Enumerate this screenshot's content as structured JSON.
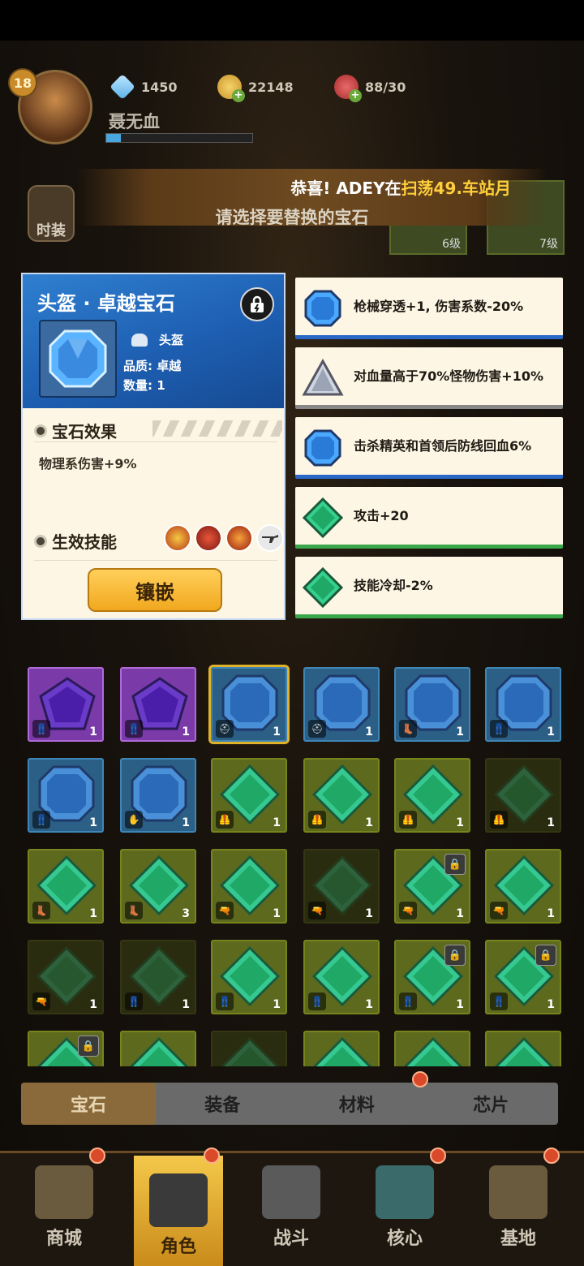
{
  "hud": {
    "level": "18",
    "player_name": "聂无血",
    "xp_fraction": 0.1,
    "diamonds": "1450",
    "coins": "22148",
    "stamina": "88/30"
  },
  "news": {
    "prefix": "恭喜! ADEY在",
    "highlight": "扫荡49.车站月",
    "prompt": "请选择要替换的宝石"
  },
  "side": {
    "costume_label": "时装"
  },
  "behind": {
    "item_level_1": "6级",
    "item_level_2": "7级"
  },
  "detail": {
    "title": "头盔 · 卓越宝石",
    "slot_label": "头盔",
    "quality_line": "品质: 卓越",
    "quantity_line": "数量: 1",
    "effect_title": "宝石效果",
    "effect_text": "物理系伤害+9%",
    "skill_title": "生效技能",
    "skills": [
      "skill-1",
      "skill-2",
      "skill-3",
      "skill-rifle"
    ],
    "inlay_label": "镶嵌"
  },
  "replace_options": [
    {
      "text": "枪械穿透+1, 伤害系数-20%",
      "gem": "blue"
    },
    {
      "text": "对血量高于70%怪物伤害+10%",
      "gem": "grey"
    },
    {
      "text": "击杀精英和首领后防线回血6%",
      "gem": "blue"
    },
    {
      "text": "攻击+20",
      "gem": "green"
    },
    {
      "text": "技能冷却-2%",
      "gem": "green"
    }
  ],
  "inventory": [
    {
      "color": "purple",
      "count": "1",
      "slot": "pants"
    },
    {
      "color": "purple",
      "count": "1",
      "slot": "pants"
    },
    {
      "color": "blue",
      "count": "1",
      "slot": "helmet",
      "selected": true
    },
    {
      "color": "blue",
      "count": "1",
      "slot": "helmet"
    },
    {
      "color": "blue",
      "count": "1",
      "slot": "boots"
    },
    {
      "color": "blue",
      "count": "1",
      "slot": "pants"
    },
    {
      "color": "blue",
      "count": "1",
      "slot": "pants"
    },
    {
      "color": "blue",
      "count": "1",
      "slot": "glove"
    },
    {
      "color": "green",
      "count": "1",
      "slot": "armor"
    },
    {
      "color": "green",
      "count": "1",
      "slot": "armor"
    },
    {
      "color": "green",
      "count": "1",
      "slot": "armor"
    },
    {
      "color": "dark",
      "count": "1",
      "slot": "armor"
    },
    {
      "color": "green",
      "count": "1",
      "slot": "boots"
    },
    {
      "color": "green",
      "count": "3",
      "slot": "boots"
    },
    {
      "color": "green",
      "count": "1",
      "slot": "gun"
    },
    {
      "color": "dark",
      "count": "1",
      "slot": "gun"
    },
    {
      "color": "green",
      "count": "1",
      "slot": "gun",
      "locked": true
    },
    {
      "color": "green",
      "count": "1",
      "slot": "gun"
    },
    {
      "color": "dark",
      "count": "1",
      "slot": "gun"
    },
    {
      "color": "dark",
      "count": "1",
      "slot": "pants"
    },
    {
      "color": "green",
      "count": "1",
      "slot": "pants"
    },
    {
      "color": "green",
      "count": "1",
      "slot": "pants"
    },
    {
      "color": "green",
      "count": "1",
      "slot": "pants",
      "locked": true
    },
    {
      "color": "green",
      "count": "1",
      "slot": "pants",
      "locked": true
    },
    {
      "color": "green",
      "count": "",
      "slot": "",
      "locked": true
    },
    {
      "color": "green",
      "count": "",
      "slot": ""
    },
    {
      "color": "dark",
      "count": "",
      "slot": ""
    },
    {
      "color": "green",
      "count": "",
      "slot": ""
    },
    {
      "color": "green",
      "count": "",
      "slot": ""
    },
    {
      "color": "green",
      "count": "",
      "slot": ""
    }
  ],
  "tabs": [
    "宝石",
    "装备",
    "材料",
    "芯片"
  ],
  "active_tab": 0,
  "nav": [
    {
      "label": "商城",
      "icon": "shop-icon"
    },
    {
      "label": "角色",
      "icon": "character-icon",
      "active": true
    },
    {
      "label": "战斗",
      "icon": "battle-icon"
    },
    {
      "label": "核心",
      "icon": "core-icon"
    },
    {
      "label": "基地",
      "icon": "base-icon"
    }
  ],
  "colors": {
    "panel_blue": "#2f7fd0",
    "card_bg": "#fdf6e4",
    "accent_gold": "#f1a81e",
    "gem_blue": "#4aa8ff",
    "gem_green": "#2fd08a"
  }
}
